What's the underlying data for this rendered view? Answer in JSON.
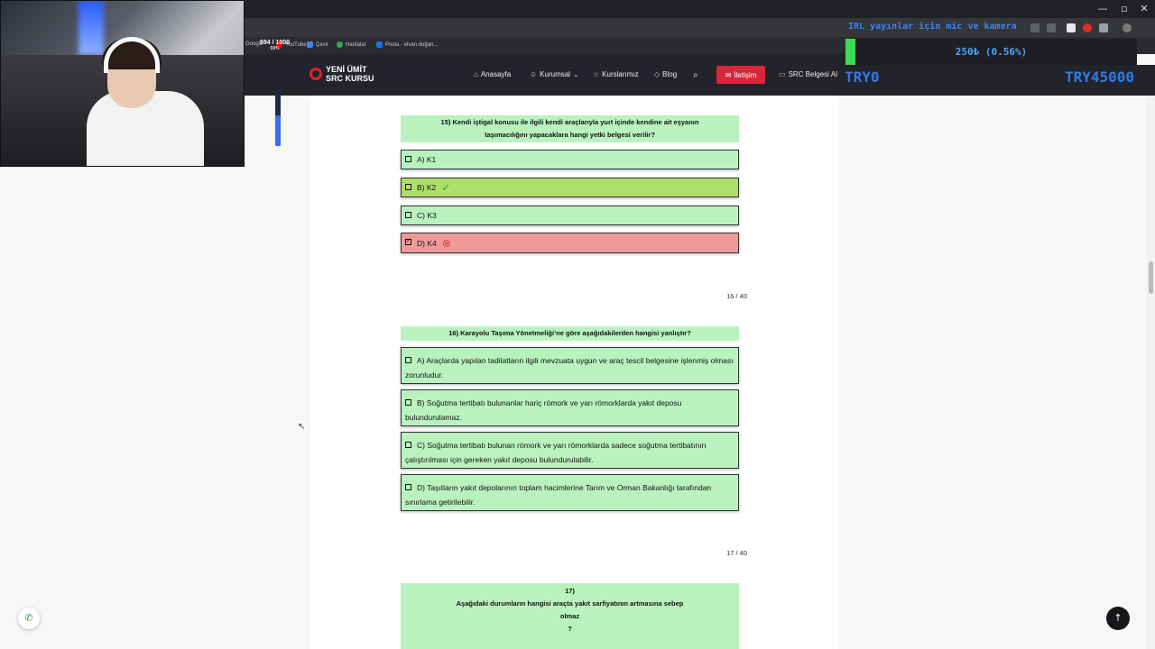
{
  "browser": {
    "window_controls": [
      "—",
      "▫",
      "✕"
    ],
    "bookmarks": [
      {
        "label": "Google",
        "color": "#4285f4"
      },
      {
        "label": "YouTube",
        "color": "#ff0000"
      },
      {
        "label": "Çevir",
        "color": "#4285f4"
      },
      {
        "label": "Haritalar",
        "color": "#34a853"
      },
      {
        "label": "Posta - elvan doğan...",
        "color": "#1a73e8"
      }
    ]
  },
  "stream": {
    "ticker": "IRL yayınlar için mic ve kamera",
    "counter": "594 / 1000",
    "counter_pct": "59%",
    "goal_text": "250₺ (0.56%)",
    "goal_fraction": 0.0056,
    "goal_start": "TRY0",
    "goal_end": "TRY45000",
    "volume_level": 0.55
  },
  "site": {
    "logo_line1": "YENİ ÜMİT",
    "logo_line2": "SRC KURSU",
    "nav": {
      "home": "Anasayfa",
      "corporate": "Kurumsal",
      "courses": "Kurslarımız",
      "blog": "Blog",
      "contact": "İletişim",
      "src_ai": "SRC Belgesi AI"
    }
  },
  "quiz": {
    "q15": {
      "title": "15) Kendi iştigal konusu ile ilgili kendi araçlarıyla yurt içinde kendine ait eşyanın taşımacılığını yapacaklara hangi yetki belgesi verilir?",
      "options": [
        "A) K1",
        "B) K2",
        "C) K3",
        "D) K4"
      ],
      "correct_index": 1,
      "selected_index": 3
    },
    "pager_16": "16 / 40",
    "q16": {
      "title": "16)  Karayolu Taşıma Yönetmeliği’ne göre aşağıdakilerden hangisi yanlıştır?",
      "options": [
        "A) Araçlarda yapılan tadilatların ilgili mevzuata uygun ve araç tescil belgesine işlenmiş olması zorunludur.",
        "B) Soğutma tertibatı bulunanlar hariç römork ve yarı römorklarda yakıt deposu bulundurulamaz.",
        "C) Soğutma tertibatı bulunan römork ve yarı römorklarda sadece soğutma tertibatının çalıştırılması için gereken yakıt deposu bulundurulabilir.",
        "D) Taşıtların yakıt depolarının toplam hacimlerine Tarım ve Orman Bakanlığı tarafından sınırlama getirilebilir."
      ]
    },
    "pager_17": "17 / 40",
    "q17": {
      "number": "17)",
      "line1": "Aşağıdaki durumların hangisi araçta yakıt sarfiyatının artmasına sebep",
      "line2": "olmaz",
      "line3": "?"
    }
  },
  "colors": {
    "option_bg": "#b9f2bf",
    "correct_bg": "#aedf6b",
    "wrong_bg": "#ef9a9a",
    "header_bg": "#23232b",
    "contact_btn": "#d8263b"
  },
  "icons": {
    "whatsapp": "whatsapp-icon",
    "scroll_top": "arrow-up-icon",
    "search": "search-icon"
  }
}
